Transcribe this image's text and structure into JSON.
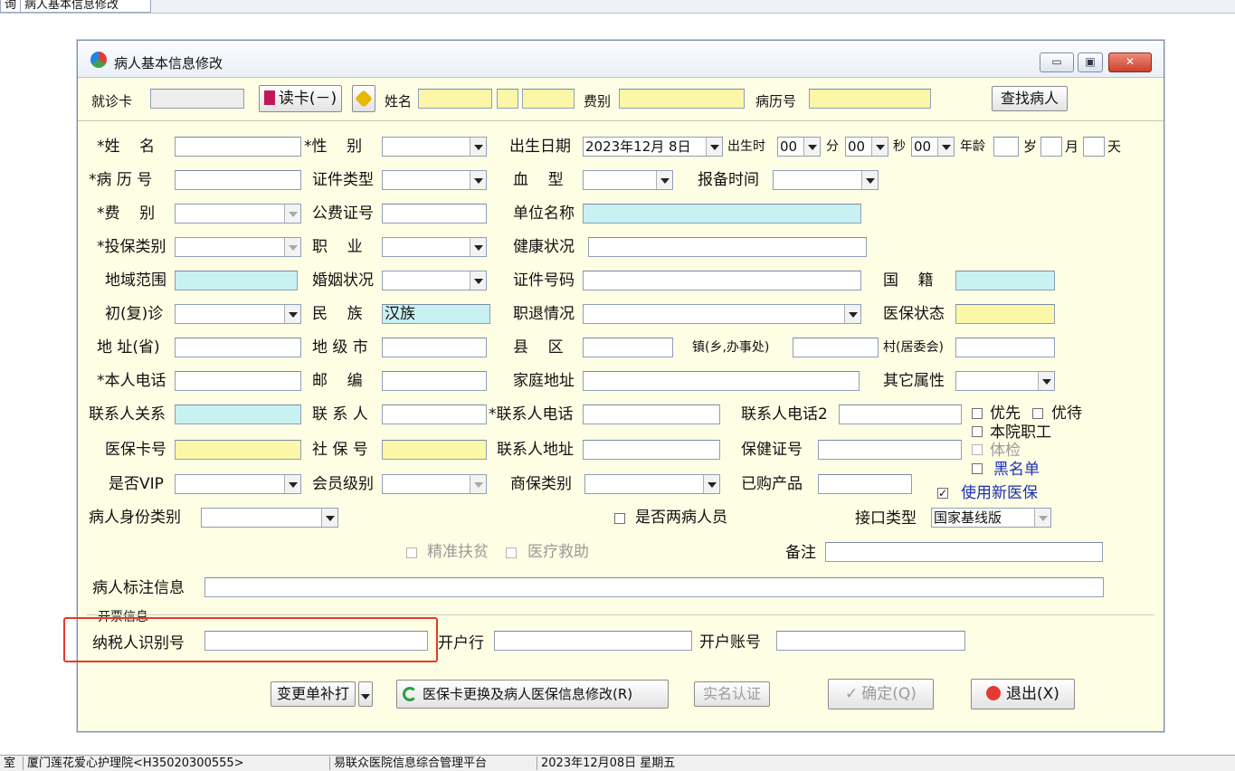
{
  "app": {
    "tabs": [
      "询",
      "病人基本信息修改"
    ],
    "status": [
      "室",
      "厦门莲花爱心护理院<H35020300555>",
      "易联众医院信息综合管理平台",
      "2023年12月08日  星期五"
    ]
  },
  "dialog": {
    "title": "病人基本信息修改",
    "window_buttons": {
      "min": "▭",
      "max": "▣",
      "close": "✕"
    }
  },
  "top": {
    "card_label": "就诊卡",
    "read_card_btn": "读卡(－)",
    "name_label": "姓名",
    "fee_label": "费别",
    "record_label": "病历号",
    "find_btn": "查找病人"
  },
  "form": {
    "name": "*姓    名",
    "gender": "*性    别",
    "birth": "出生日期",
    "birth_value": "2023年12月 8日",
    "birth_hour": "出生时",
    "hour_value": "00",
    "min": "分",
    "min_value": "00",
    "sec": "秒",
    "sec_value": "00",
    "age": "年龄",
    "sui": "岁",
    "yue": "月",
    "tian": "天",
    "record_no": "*病 历 号",
    "id_type": "证件类型",
    "blood": "血    型",
    "report_time": "报备时间",
    "fee_type": "*费    别",
    "public_no": "公费证号",
    "unit": "单位名称",
    "insure_type": "*投保类别",
    "job": "职    业",
    "health": "健康状况",
    "region": "地域范围",
    "marriage": "婚姻状况",
    "id_no": "证件号码",
    "nation_lbl": "国    籍",
    "visit": "初(复)诊",
    "ethnic": "民    族",
    "ethnic_value": "汉族",
    "retire": "职退情况",
    "med_status": "医保状态",
    "addr_prov": "地 址(省)",
    "city": "地 级 市",
    "county": "县    区",
    "town": "镇(乡,办事处)",
    "village": "村(居委会)",
    "phone": "*本人电话",
    "postcode": "邮    编",
    "home_addr": "家庭地址",
    "other_attr": "其它属性",
    "contact_rel": "联系人关系",
    "contact": "联 系 人",
    "contact_phone": "*联系人电话",
    "contact_phone2": "联系人电话2",
    "priority": "优先",
    "special": "优待",
    "staff": "本院职工",
    "physical": "体检",
    "blacklist": "黑名单",
    "new_insurance": "使用新医保",
    "med_card": "医保卡号",
    "social_no": "社 保 号",
    "contact_addr": "联系人地址",
    "health_cert": "保健证号",
    "vip": "是否VIP",
    "member_level": "会员级别",
    "commercial": "商保类别",
    "purchased": "已购产品",
    "identity": "病人身份类别",
    "two_disease": "是否两病人员",
    "interface": "接口类型",
    "interface_value": "国家基线版",
    "poverty": "精准扶贫",
    "medical_aid": "医疗救助",
    "remark": "备注",
    "tag_info": "病人标注信息",
    "invoice_group": "开票信息",
    "taxpayer": "纳税人识别号",
    "bank": "开户行",
    "account": "开户账号"
  },
  "buttons": {
    "reprint": "变更单补打",
    "change_card": "医保卡更换及病人医保信息修改(R)",
    "verify": "实名认证",
    "ok": "确定(Q)",
    "exit": "退出(X)"
  },
  "colors": {
    "dialog_bg": "#fefee4",
    "yellow_field": "#fcf6a8",
    "cyan_field": "#c8f1f1",
    "highlight": "#e5392a"
  }
}
